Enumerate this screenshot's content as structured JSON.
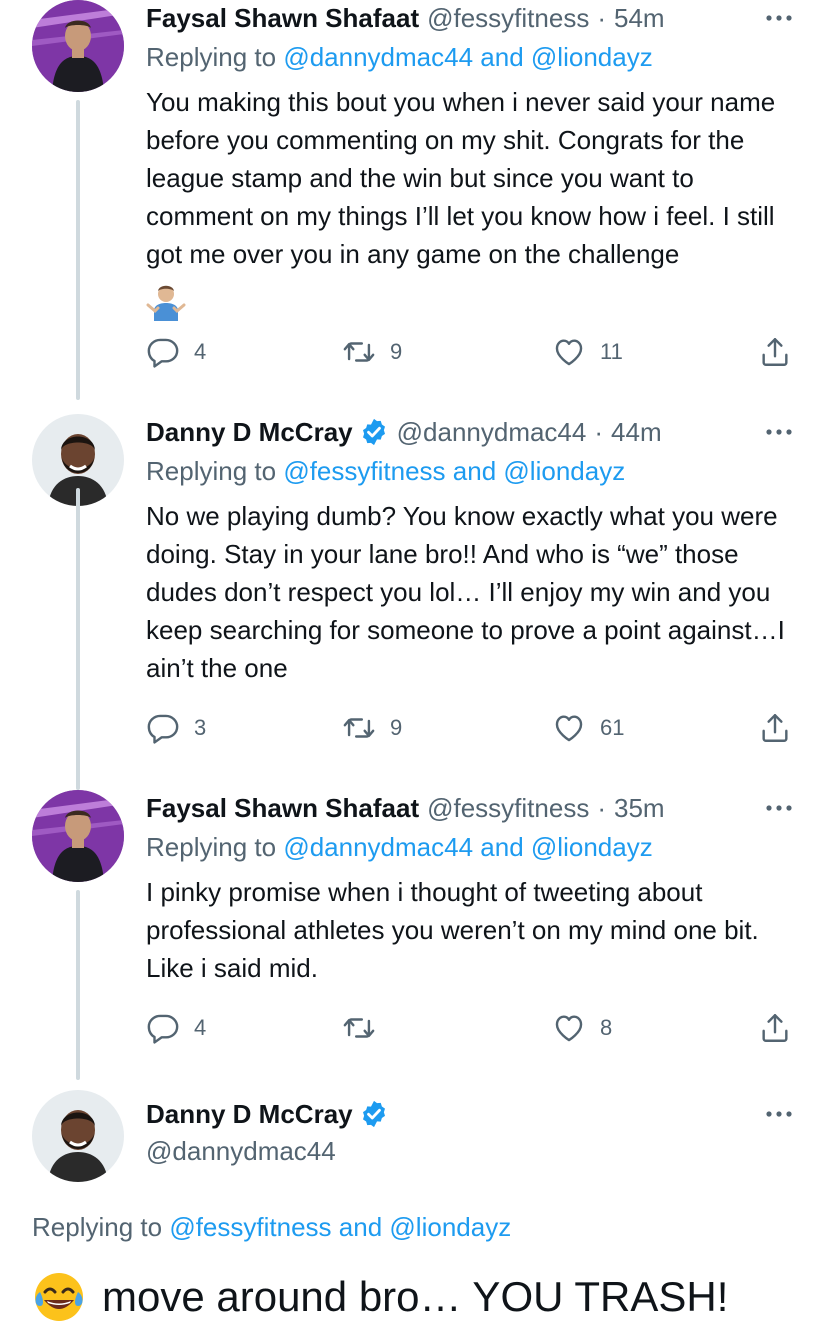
{
  "tweets": [
    {
      "name": "Faysal Shawn Shafaat",
      "handle": "@fessyfitness",
      "separator": "·",
      "time": "54m",
      "replying_prefix": "Replying to",
      "mention_1": "@dannydmac44",
      "and": "and",
      "mention_2": "@liondayz",
      "text": "You making this bout you when i never said your name before you commenting on my shit. Congrats for the league stamp and the win but since you want to comment on my things I’ll let you know how i feel. I still got me over you in any game on the challenge",
      "emoji": "person-shrugging-icon",
      "replies": "4",
      "retweets": "9",
      "likes": "11"
    },
    {
      "name": "Danny D McCray",
      "handle": "@dannydmac44",
      "separator": "·",
      "time": "44m",
      "replying_prefix": "Replying to",
      "mention_1": "@fessyfitness",
      "and": "and",
      "mention_2": "@liondayz",
      "text": "No we playing dumb? You know exactly what you were doing. Stay in your lane bro!! And who is “we” those dudes don’t respect you lol… I’ll enjoy my win and you keep searching for someone to prove a point against…I ain’t the one",
      "replies": "3",
      "retweets": "9",
      "likes": "61"
    },
    {
      "name": "Faysal Shawn Shafaat",
      "handle": "@fessyfitness",
      "separator": "·",
      "time": "35m",
      "replying_prefix": "Replying to",
      "mention_1": "@dannydmac44",
      "and": "and",
      "mention_2": "@liondayz",
      "text": "I pinky promise when i thought of tweeting about professional athletes you weren’t on my mind one bit. Like i said mid.",
      "replies": "4",
      "retweets": "",
      "likes": "8"
    }
  ],
  "main_tweet": {
    "name": "Danny D McCray",
    "handle": "@dannydmac44",
    "replying_prefix": "Replying to",
    "mention_1": "@fessyfitness",
    "and": "and",
    "mention_2": "@liondayz",
    "emoji": "face-with-tears-of-joy-icon",
    "text": "move around bro… YOU TRASH!"
  },
  "colors": {
    "link": "#1d9bf0",
    "muted": "#536471",
    "verified": "#1d9bf0",
    "thread_line": "#cfd9de"
  }
}
